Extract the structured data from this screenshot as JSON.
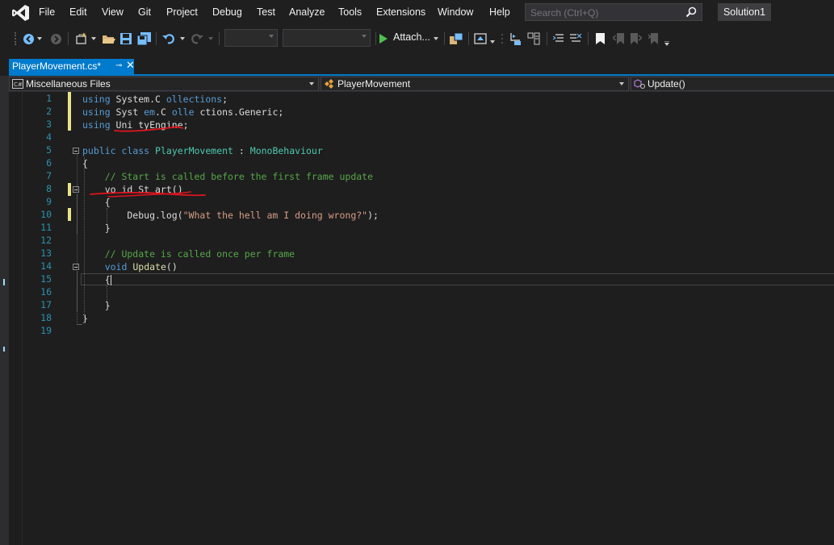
{
  "menu": {
    "items": [
      "File",
      "Edit",
      "View",
      "Git",
      "Project",
      "Debug",
      "Test",
      "Analyze",
      "Tools",
      "Extensions",
      "Window",
      "Help"
    ],
    "search_placeholder": "Search (Ctrl+Q)",
    "solution_name": "Solution1"
  },
  "toolbar": {
    "attach_label": "Attach..."
  },
  "tab": {
    "label": "PlayerMovement.cs*",
    "pin_glyph": "⊸",
    "close_glyph": "✕"
  },
  "navbar": {
    "project": "Miscellaneous Files",
    "type": "PlayerMovement",
    "member": "Update()"
  },
  "editor": {
    "line_numbers": [
      "1",
      "2",
      "3",
      "4",
      "5",
      "6",
      "7",
      "8",
      "9",
      "10",
      "11",
      "12",
      "13",
      "14",
      "15",
      "16",
      "17",
      "18",
      "19"
    ],
    "lines": [
      [
        {
          "t": "using",
          "c": "kw"
        },
        {
          "t": " System.C ",
          "c": "nm"
        },
        {
          "t": "ollections",
          "c": "kw"
        },
        {
          "t": ";",
          "c": "nm"
        }
      ],
      [
        {
          "t": "using",
          "c": "kw"
        },
        {
          "t": " Syst ",
          "c": "nm"
        },
        {
          "t": "em",
          "c": "kw"
        },
        {
          "t": ".C ",
          "c": "nm"
        },
        {
          "t": "olle",
          "c": "kw"
        },
        {
          "t": " ctions.Generic;",
          "c": "nm"
        }
      ],
      [
        {
          "t": "using",
          "c": "kw"
        },
        {
          "t": " Uni tyEngine;",
          "c": "nm"
        }
      ],
      [],
      [
        {
          "t": "public",
          "c": "kw"
        },
        {
          "t": " ",
          "c": "nm"
        },
        {
          "t": "class",
          "c": "kw"
        },
        {
          "t": " ",
          "c": "nm"
        },
        {
          "t": "PlayerMovement",
          "c": "ty"
        },
        {
          "t": " : ",
          "c": "nm"
        },
        {
          "t": "MonoBehaviour",
          "c": "ty"
        }
      ],
      [
        {
          "t": "{",
          "c": "nm"
        }
      ],
      [
        {
          "t": "    // Start is called before the first frame update",
          "c": "cm"
        }
      ],
      [
        {
          "t": "    vo id St art()",
          "c": "nm"
        }
      ],
      [
        {
          "t": "    {",
          "c": "nm"
        }
      ],
      [
        {
          "t": "        Debug.log(",
          "c": "nm"
        },
        {
          "t": "\"What the hell am I doing wrong?\"",
          "c": "st"
        },
        {
          "t": ");",
          "c": "nm"
        }
      ],
      [
        {
          "t": "    }",
          "c": "nm"
        }
      ],
      [],
      [
        {
          "t": "    // Update is called once per frame",
          "c": "cm"
        }
      ],
      [
        {
          "t": "    ",
          "c": "nm"
        },
        {
          "t": "void",
          "c": "kw"
        },
        {
          "t": " ",
          "c": "nm"
        },
        {
          "t": "Update",
          "c": "fn"
        },
        {
          "t": "()",
          "c": "nm"
        }
      ],
      [
        {
          "t": "    {",
          "c": "nm"
        }
      ],
      [],
      [
        {
          "t": "    }",
          "c": "nm"
        }
      ],
      [
        {
          "t": "}",
          "c": "nm"
        }
      ],
      []
    ]
  },
  "colors": {
    "accent": "#007acc",
    "change_marker": "#e9e38a",
    "annotation_ink": "#e0141e"
  }
}
